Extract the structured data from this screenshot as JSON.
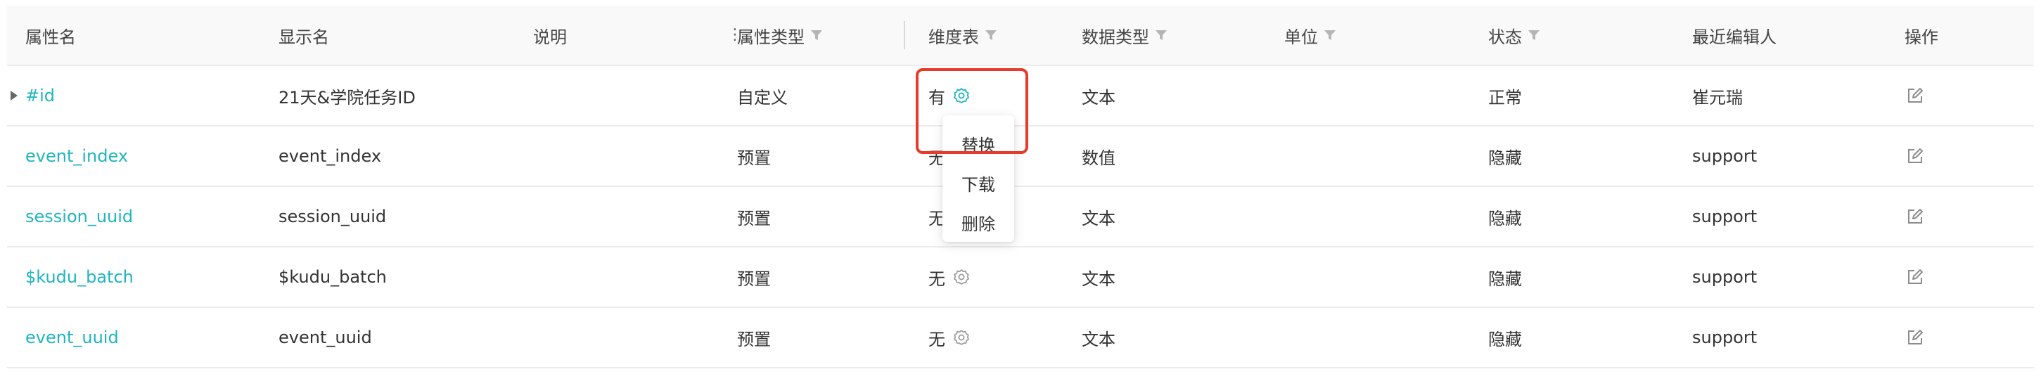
{
  "columns": {
    "name": "属性名",
    "display_name": "显示名",
    "description": "说明",
    "attr_type": "属性类型",
    "dim_table": "维度表",
    "data_type": "数据类型",
    "unit": "单位",
    "status": "状态",
    "editor": "最近编辑人",
    "actions": "操作"
  },
  "rows": [
    {
      "name": "#id",
      "display_name": "21天&学院任务ID",
      "description": "",
      "attr_type": "自定义",
      "dim_table": "有",
      "data_type": "文本",
      "unit": "",
      "status": "正常",
      "editor": "崔元瑞"
    },
    {
      "name": "event_index",
      "display_name": "event_index",
      "description": "",
      "attr_type": "预置",
      "dim_table": "无",
      "data_type": "数值",
      "unit": "",
      "status": "隐藏",
      "editor": "support"
    },
    {
      "name": "session_uuid",
      "display_name": "session_uuid",
      "description": "",
      "attr_type": "预置",
      "dim_table": "无",
      "data_type": "文本",
      "unit": "",
      "status": "隐藏",
      "editor": "support"
    },
    {
      "name": "$kudu_batch",
      "display_name": "$kudu_batch",
      "description": "",
      "attr_type": "预置",
      "dim_table": "无",
      "data_type": "文本",
      "unit": "",
      "status": "隐藏",
      "editor": "support"
    },
    {
      "name": "event_uuid",
      "display_name": "event_uuid",
      "description": "",
      "attr_type": "预置",
      "dim_table": "无",
      "data_type": "文本",
      "unit": "",
      "status": "隐藏",
      "editor": "support"
    }
  ],
  "dim_menu": {
    "replace": "替换",
    "download": "下载",
    "delete": "删除"
  },
  "icons": {
    "filter": "filter-icon",
    "gear": "gear-icon",
    "edit": "edit-icon",
    "expand": "caret-right-icon",
    "drag": "drag-handle-icon"
  },
  "colors": {
    "link": "#1fb5bf",
    "highlight": "#e8392a",
    "gear_active": "#1fb5bf",
    "gear_inactive": "#9e9e9e",
    "header_bg": "#f9f9f9"
  }
}
